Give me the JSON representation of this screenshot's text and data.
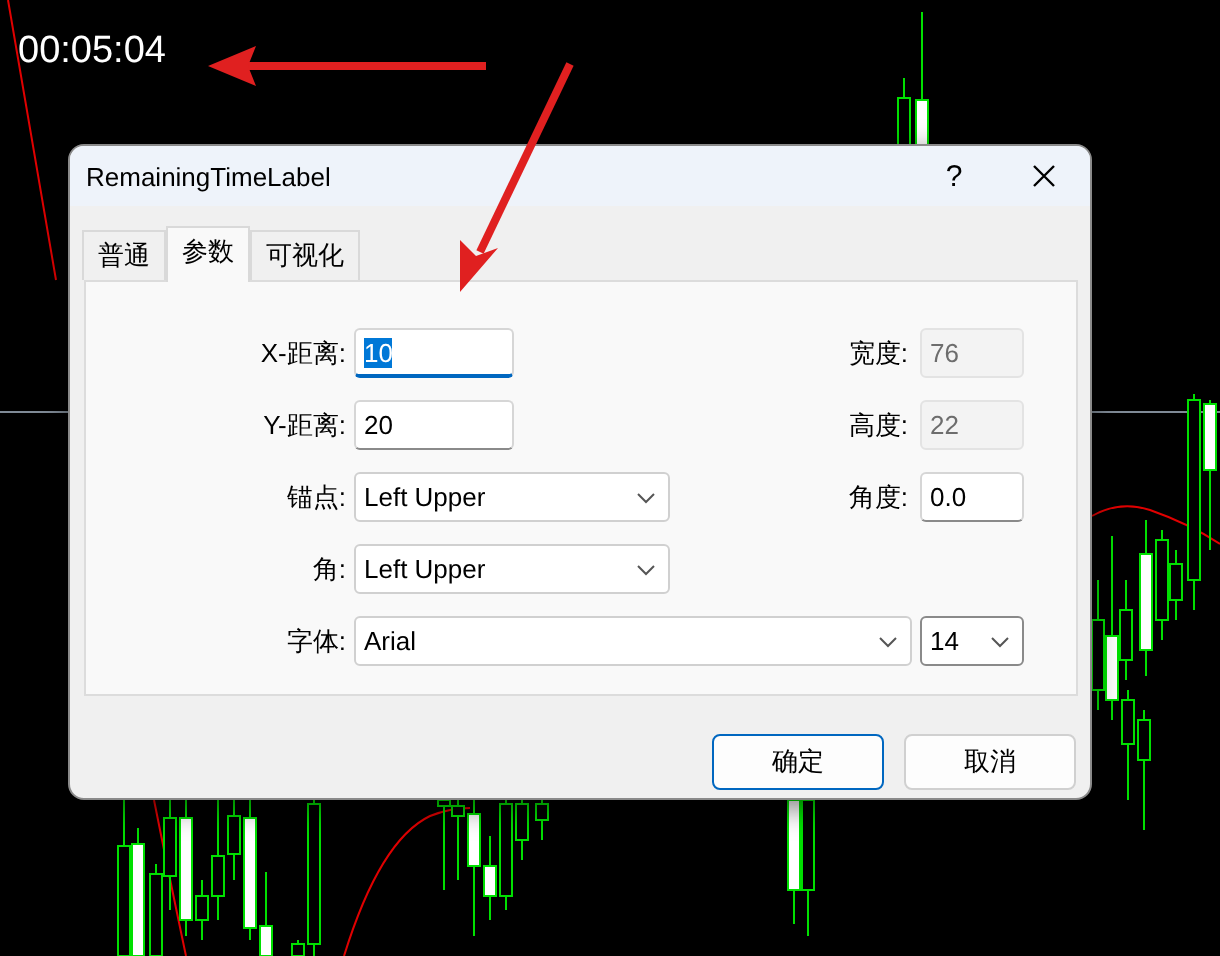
{
  "chart": {
    "timer": "00:05:04"
  },
  "dialog": {
    "title": "RemainingTimeLabel",
    "help_button": "?",
    "tabs": [
      {
        "label": "普通",
        "selected": false
      },
      {
        "label": "参数",
        "selected": true
      },
      {
        "label": "可视化",
        "selected": false
      }
    ],
    "rows": [
      [
        {
          "kind": "text",
          "label": "X-距离:",
          "value": "10",
          "focused": true,
          "disabled": false
        },
        {
          "kind": "text",
          "label": "宽度:",
          "value": "76",
          "focused": false,
          "disabled": true
        }
      ],
      [
        {
          "kind": "text",
          "label": "Y-距离:",
          "value": "20",
          "focused": false,
          "disabled": false
        },
        {
          "kind": "text",
          "label": "高度:",
          "value": "22",
          "focused": false,
          "disabled": true
        }
      ],
      [
        {
          "kind": "combo",
          "label": "锚点:",
          "value": "Left Upper"
        },
        {
          "kind": "text",
          "label": "角度:",
          "value": "0.0",
          "focused": false,
          "disabled": false
        }
      ],
      [
        {
          "kind": "combo",
          "label": "角:",
          "value": "Left Upper"
        }
      ],
      [
        {
          "kind": "combo",
          "label": "字体:",
          "value": "Arial"
        },
        {
          "kind": "combo",
          "value": "14"
        }
      ]
    ],
    "buttons": [
      {
        "label": "确定",
        "default": true
      },
      {
        "label": "取消",
        "default": false
      }
    ]
  }
}
